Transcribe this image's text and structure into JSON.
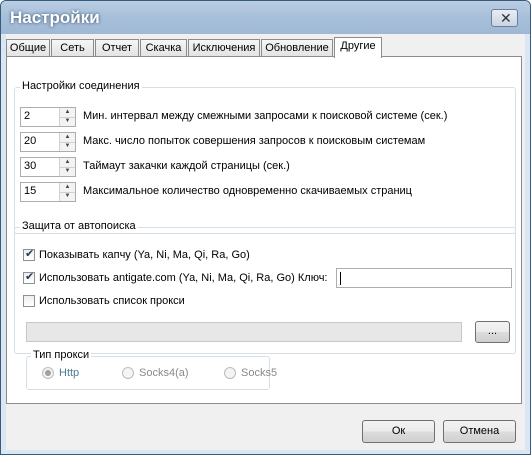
{
  "window": {
    "title": "Настройки",
    "close_symbol": "✕"
  },
  "tabs": [
    {
      "label": "Общие"
    },
    {
      "label": "Сеть"
    },
    {
      "label": "Отчет"
    },
    {
      "label": "Скачка"
    },
    {
      "label": "Исключения"
    },
    {
      "label": "Обновление"
    },
    {
      "label": "Другие"
    }
  ],
  "active_tab": "Другие",
  "connection": {
    "title": "Настройки соединения",
    "rows": [
      {
        "value": "2",
        "label": "Мин. интервал между смежными запросами к поисковой системе (сек.)"
      },
      {
        "value": "20",
        "label": "Макс. число попыток совершения запросов к поисковым системам"
      },
      {
        "value": "30",
        "label": "Таймаут закачки каждой страницы (сек.)"
      },
      {
        "value": "15",
        "label": "Максимальное количество одновременно скачиваемых страниц"
      }
    ]
  },
  "protection": {
    "title": "Защита от автопоиска",
    "show_captcha": {
      "label": "Показывать капчу (Ya, Ni, Ma, Qi, Ra, Go)",
      "checked": true
    },
    "use_antigate": {
      "label": "Использовать antigate.com (Ya, Ni, Ma, Qi, Ra, Go) Ключ:",
      "checked": true,
      "key_value": ""
    },
    "use_proxy_list": {
      "label": "Использовать список прокси",
      "checked": false
    },
    "proxy_path": "",
    "browse_label": "...",
    "proxy_type": {
      "title": "Тип прокси",
      "options": [
        {
          "label": "Http",
          "selected": true
        },
        {
          "label": "Socks4(a)",
          "selected": false
        },
        {
          "label": "Socks5",
          "selected": false
        }
      ]
    }
  },
  "buttons": {
    "ok": "Ок",
    "cancel": "Отмена"
  },
  "icons": {
    "spin_up": "▲",
    "spin_down": "▼",
    "check": "✔"
  }
}
